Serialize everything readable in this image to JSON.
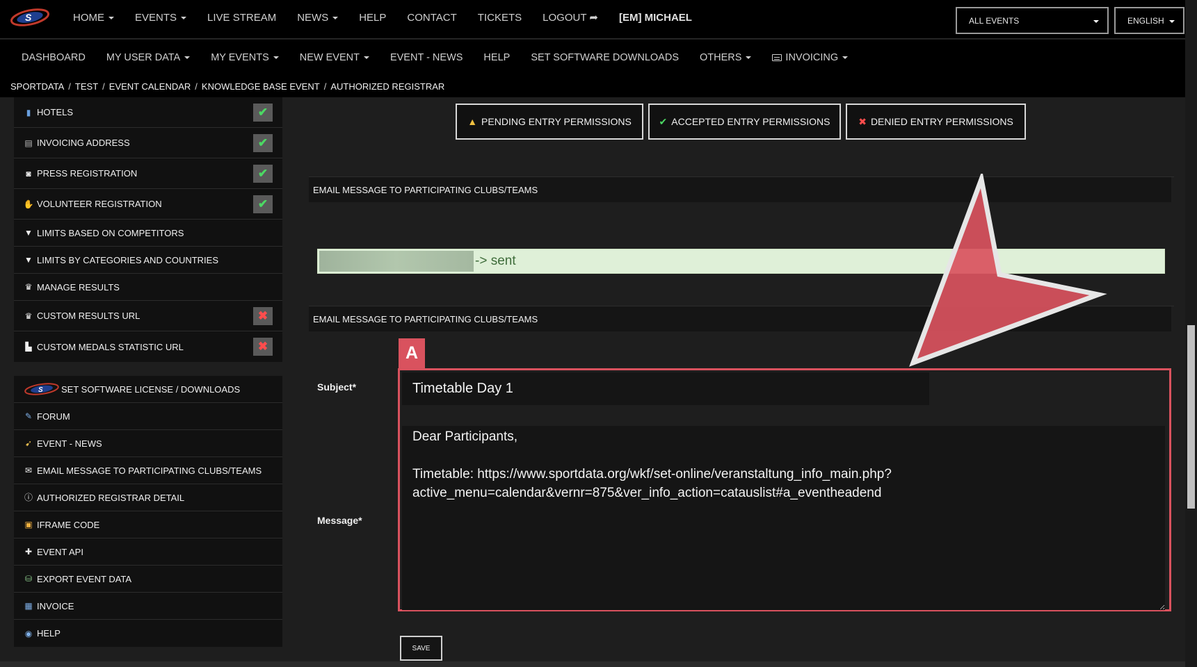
{
  "topnav": {
    "items": [
      {
        "label": "HOME"
      },
      {
        "label": "EVENTS"
      },
      {
        "label": "LIVE STREAM"
      },
      {
        "label": "NEWS"
      },
      {
        "label": "HELP"
      },
      {
        "label": "CONTACT"
      },
      {
        "label": "TICKETS"
      },
      {
        "label": "LOGOUT"
      },
      {
        "label": "[EM] MICHAEL"
      }
    ],
    "event_select": "ALL EVENTS",
    "language_select": "ENGLISH"
  },
  "subnav": {
    "items": [
      {
        "label": "DASHBOARD"
      },
      {
        "label": "MY USER DATA"
      },
      {
        "label": "MY EVENTS"
      },
      {
        "label": "NEW EVENT"
      },
      {
        "label": "EVENT - NEWS"
      },
      {
        "label": "HELP"
      },
      {
        "label": "SET SOFTWARE DOWNLOADS"
      },
      {
        "label": "OTHERS"
      },
      {
        "label": "INVOICING"
      }
    ]
  },
  "breadcrumb": [
    "SPORTDATA",
    "TEST",
    "EVENT CALENDAR",
    "KNOWLEDGE BASE EVENT",
    "AUTHORIZED REGISTRAR"
  ],
  "sidebar": {
    "group1": [
      {
        "label": "HOTELS",
        "icon": "hotel-icon",
        "status": "✔"
      },
      {
        "label": "INVOICING ADDRESS",
        "icon": "document-icon",
        "status": "✔"
      },
      {
        "label": "PRESS REGISTRATION",
        "icon": "camera-icon",
        "status": "✔"
      },
      {
        "label": "VOLUNTEER REGISTRATION",
        "icon": "hand-icon",
        "status": "✔"
      },
      {
        "label": "LIMITS BASED ON COMPETITORS",
        "icon": "filter-icon"
      },
      {
        "label": "LIMITS BY CATEGORIES AND COUNTRIES",
        "icon": "filter-icon"
      },
      {
        "label": "MANAGE RESULTS",
        "icon": "trophy-icon"
      },
      {
        "label": "CUSTOM RESULTS URL",
        "icon": "trophy-icon",
        "status": "✖"
      },
      {
        "label": "CUSTOM MEDALS STATISTIC URL",
        "icon": "bar-chart-icon",
        "status": "✖"
      }
    ],
    "group2": [
      {
        "label": "SET SOFTWARE LICENSE / DOWNLOADS",
        "icon": "set-logo-icon"
      },
      {
        "label": "FORUM",
        "icon": "forum-icon"
      },
      {
        "label": "EVENT - NEWS",
        "icon": "rocket-icon"
      },
      {
        "label": "EMAIL MESSAGE TO PARTICIPATING CLUBS/TEAMS",
        "icon": "envelope-icon"
      },
      {
        "label": "AUTHORIZED REGISTRAR DETAIL",
        "icon": "info-icon"
      },
      {
        "label": "IFRAME CODE",
        "icon": "code-icon"
      },
      {
        "label": "EVENT API",
        "icon": "puzzle-icon"
      },
      {
        "label": "EXPORT EVENT DATA",
        "icon": "database-icon"
      },
      {
        "label": "INVOICE",
        "icon": "spreadsheet-icon"
      },
      {
        "label": "HELP",
        "icon": "help-icon"
      }
    ]
  },
  "permissions": {
    "pending": "PENDING ENTRY PERMISSIONS",
    "accepted": "ACCEPTED ENTRY PERMISSIONS",
    "denied": "DENIED ENTRY PERMISSIONS"
  },
  "email": {
    "section_title_1": "EMAIL MESSAGE TO PARTICIPATING CLUBS/TEAMS",
    "sent_text": "-> sent",
    "section_title_2": "EMAIL MESSAGE TO PARTICIPATING CLUBS/TEAMS",
    "annotation_label": "A",
    "subject_label": "Subject*",
    "subject_value": "Timetable Day 1",
    "message_label": "Message*",
    "message_value": "Dear Participants,\n\nTimetable: https://www.sportdata.org/wkf/set-online/veranstaltung_info_main.php?\nactive_menu=calendar&vernr=875&ver_info_action=catauslist#a_eventheadend",
    "save_label": "SAVE"
  },
  "colors": {
    "accent_red": "#d9525e",
    "sent_bg": "#dff0d8",
    "ok_green": "#4cd964",
    "deny_red": "#ff4d4d"
  }
}
